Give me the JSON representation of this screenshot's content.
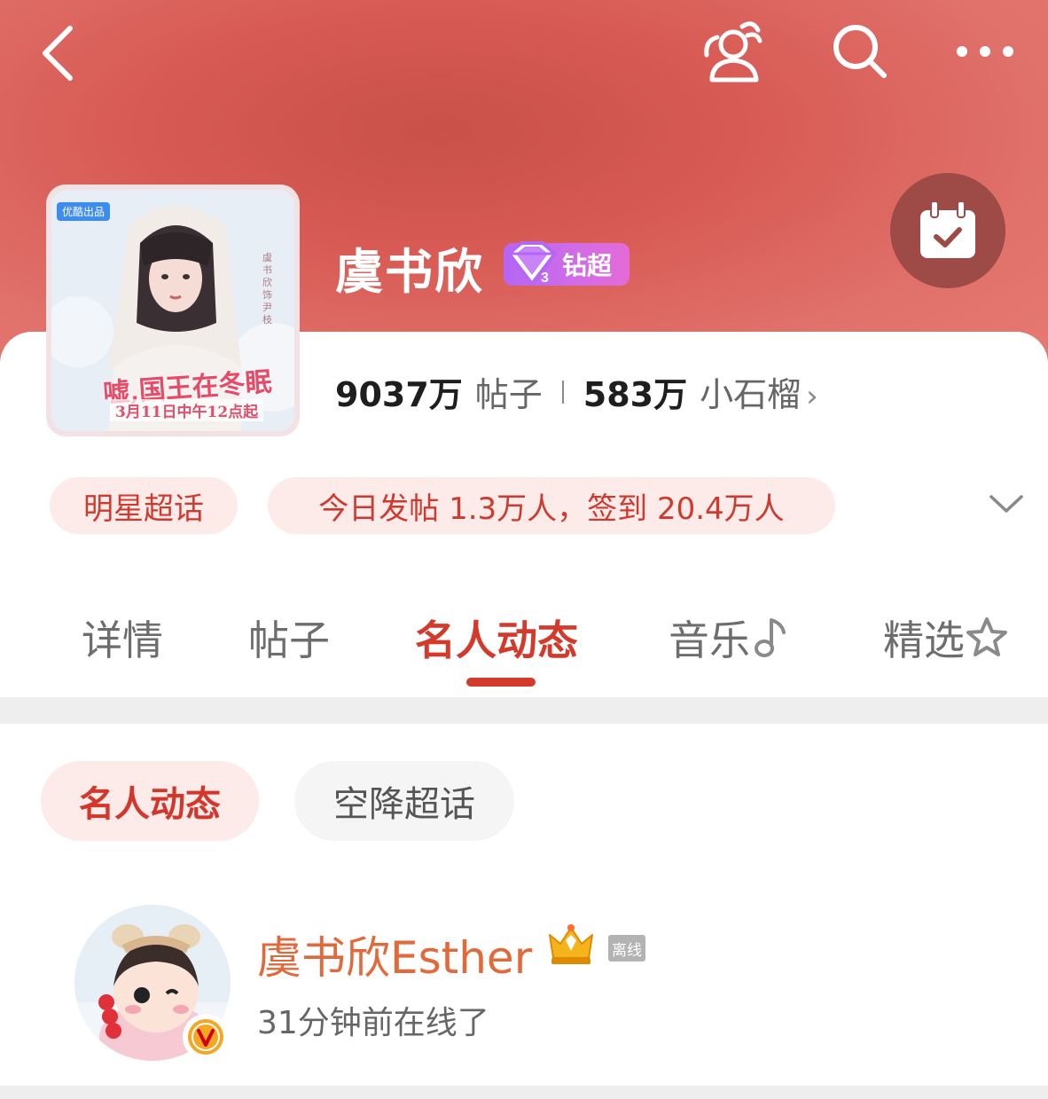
{
  "header": {
    "back_icon": "chevron-left-icon",
    "group_icon": "group-chat-icon",
    "search_icon": "search-icon",
    "more_icon": "more-horizontal-icon",
    "checkin_icon": "calendar-check-icon",
    "checkin_label": "",
    "banner_color": "#d85a54"
  },
  "topic": {
    "name": "虞书欣",
    "badge_label": "钻超",
    "badge_level": "3",
    "cover": {
      "badge": "优酷出品",
      "title": "嘘,国王在冬眠",
      "date": "3月11日中午12点起"
    },
    "stats": {
      "posts_value": "9037万",
      "posts_label": "帖子",
      "fans_value": "583万",
      "fans_label": "小石榴"
    },
    "category": "明星超话",
    "daily_stats": "今日发帖 1.3万人，签到 20.4万人"
  },
  "tabs": [
    {
      "label": "详情"
    },
    {
      "label": "帖子"
    },
    {
      "label": "名人动态"
    },
    {
      "label": "音乐"
    },
    {
      "label": "精选"
    }
  ],
  "chips": [
    {
      "label": "名人动态"
    },
    {
      "label": "空降超话"
    }
  ],
  "celebrity": {
    "name": "虞书欣Esther",
    "status_badge": "离线",
    "last_online": "31分钟前在线了"
  },
  "colors": {
    "accent": "#d33a2c",
    "name_orange": "#e2693a",
    "pill_bg": "#fcebe9"
  }
}
